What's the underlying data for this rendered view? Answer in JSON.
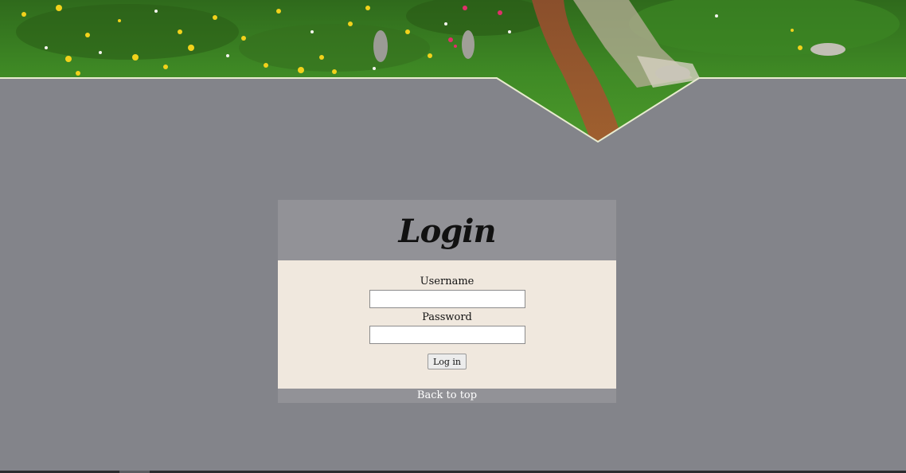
{
  "hero": {
    "image": "grassy-meadow-dirt-trail"
  },
  "login": {
    "title": "Login",
    "username_label": "Username",
    "username_value": "",
    "password_label": "Password",
    "password_value": "",
    "submit_label": "Log in"
  },
  "footer": {
    "back_to_top": "Back to top"
  },
  "colors": {
    "page_background": "#83848a",
    "card_header": "#929297",
    "card_body": "#f0e8de",
    "hero_edge": "#e8ecd0"
  }
}
